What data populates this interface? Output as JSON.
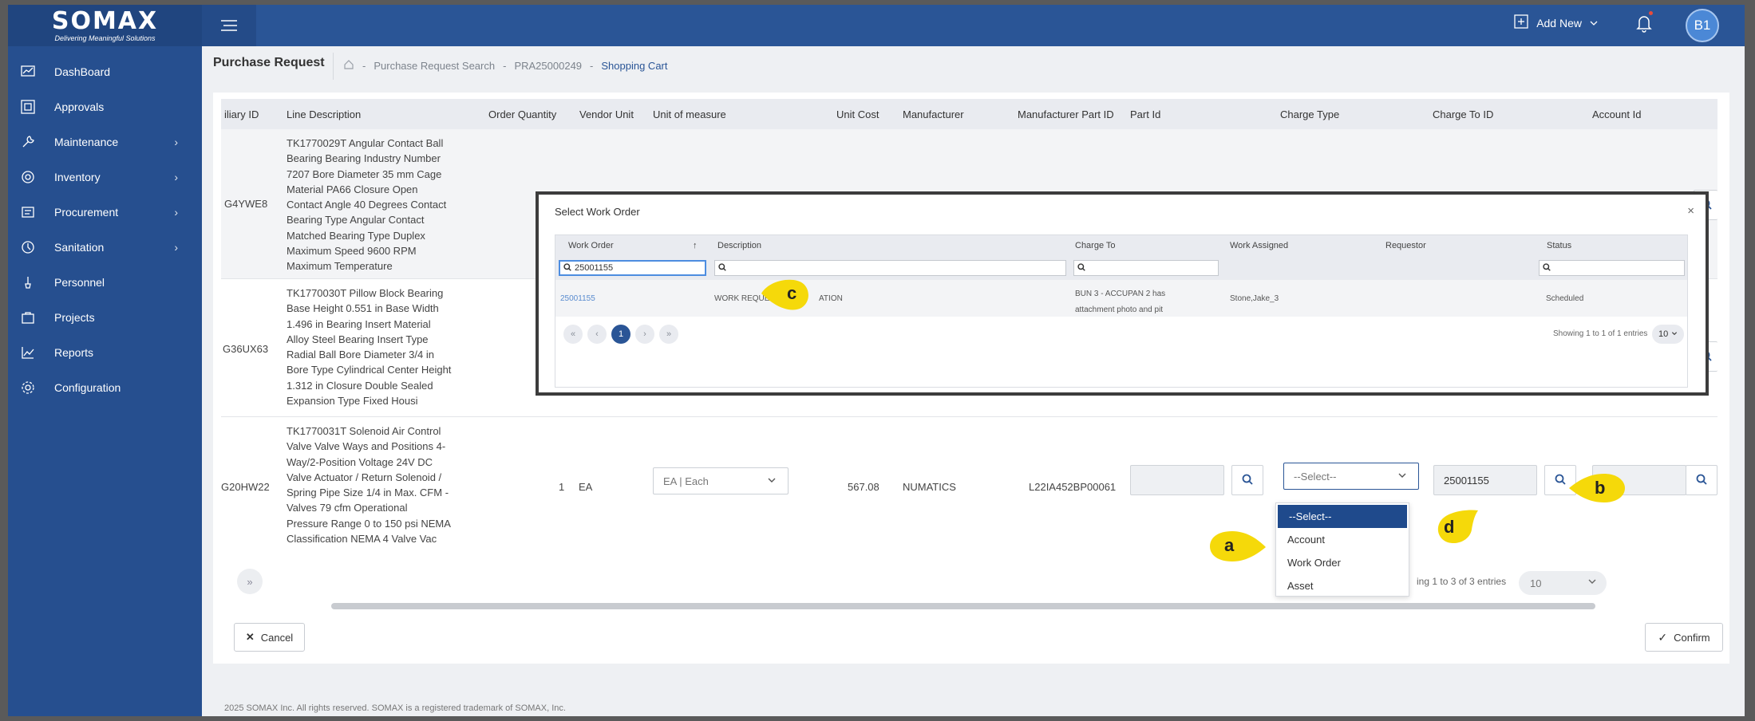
{
  "brand": {
    "name": "SOMAX",
    "tagline": "Delivering Meaningful Solutions"
  },
  "sidebar": {
    "items": [
      {
        "label": "DashBoard",
        "icon": "dashboard-icon",
        "has_children": false
      },
      {
        "label": "Approvals",
        "icon": "approvals-icon",
        "has_children": false
      },
      {
        "label": "Maintenance",
        "icon": "maintenance-icon",
        "has_children": true
      },
      {
        "label": "Inventory",
        "icon": "inventory-icon",
        "has_children": true
      },
      {
        "label": "Procurement",
        "icon": "procurement-icon",
        "has_children": true
      },
      {
        "label": "Sanitation",
        "icon": "sanitation-icon",
        "has_children": true
      },
      {
        "label": "Personnel",
        "icon": "personnel-icon",
        "has_children": false
      },
      {
        "label": "Projects",
        "icon": "projects-icon",
        "has_children": false
      },
      {
        "label": "Reports",
        "icon": "reports-icon",
        "has_children": false
      },
      {
        "label": "Configuration",
        "icon": "configuration-icon",
        "has_children": false
      }
    ]
  },
  "header": {
    "add_new": "Add New",
    "avatar": "B1"
  },
  "page": {
    "title": "Purchase Request",
    "breadcrumb": [
      "Purchase Request Search",
      "PRA25000249",
      "Shopping Cart"
    ],
    "sep": "-"
  },
  "table": {
    "columns": [
      "iliary ID",
      "Line Description",
      "Order Quantity",
      "Vendor Unit",
      "Unit of measure",
      "Unit Cost",
      "Manufacturer",
      "Manufacturer Part ID",
      "Part Id",
      "Charge Type",
      "Charge To ID",
      "Account Id"
    ],
    "rows": [
      {
        "aux_id": "G4YWE8",
        "description": [
          "TK1770029T Angular Contact Ball",
          "Bearing Bearing Industry Number",
          "7207 Bore Diameter 35 mm Cage",
          "Material PA66 Closure Open",
          "Contact Angle 40 Degrees Contact",
          "Bearing Type Angular Contact",
          "Matched Bearing Type Duplex",
          "Maximum Speed 9600 RPM",
          "Maximum Temperature"
        ]
      },
      {
        "aux_id": "G36UX63",
        "description": [
          "TK1770030T Pillow Block Bearing",
          "Base Height 0.551 in Base Width",
          "1.496 in Bearing Insert Material",
          "Alloy Steel Bearing Insert Type",
          "Radial Ball Bore Diameter 3/4 in",
          "Bore Type Cylindrical Center Height",
          "1.312 in Closure Double Sealed",
          "Expansion Type Fixed Housi"
        ]
      },
      {
        "aux_id": "G20HW22",
        "description": [
          "TK1770031T Solenoid Air Control",
          "Valve Valve Ways and Positions 4-",
          "Way/2-Position Voltage 24V DC",
          "Valve Actuator / Return Solenoid /",
          "Spring Pipe Size 1/4 in Max. CFM -",
          "Valves 79 cfm Operational",
          "Pressure Range 0 to 150 psi NEMA",
          "Classification NEMA 4 Valve Vac"
        ],
        "order_qty": "1",
        "vendor_unit": "EA",
        "uom": "EA | Each",
        "unit_cost": "567.08",
        "manufacturer": "NUMATICS",
        "mfr_part_id": "L22IA452BP00061",
        "charge_type_placeholder": "--Select--",
        "charge_to_id": "25001155"
      }
    ],
    "charge_type_options": [
      "--Select--",
      "Account",
      "Work Order",
      "Asset"
    ],
    "showing": "ing 1 to 3 of 3 entries",
    "page_size": "10"
  },
  "buttons": {
    "cancel": "Cancel",
    "confirm": "Confirm"
  },
  "footer": "2025 SOMAX Inc. All rights reserved. SOMAX is a registered trademark of SOMAX, Inc.",
  "modal": {
    "title": "Select Work Order",
    "close": "×",
    "columns": [
      "Work Order",
      "Description",
      "Charge To",
      "Work Assigned",
      "Requestor",
      "Status"
    ],
    "filter_value": "25001155",
    "rows": [
      {
        "work_order": "25001155",
        "description": "WORK REQUE",
        "description_tail": "ATION",
        "charge_to": [
          "BUN 3 - ACCUPAN 2 has",
          "attachment photo and pit"
        ],
        "work_assigned": "Stone,Jake_3",
        "requestor": "",
        "status": "Scheduled"
      }
    ],
    "page": "1",
    "showing": "Showing 1 to 1 of 1 entries",
    "page_size": "10"
  },
  "callouts": {
    "a": "a",
    "b": "b",
    "c": "c",
    "d": "d",
    "color": "#f5d90a"
  },
  "colors": {
    "sidebar": "#264f8f",
    "header": "#2a5596",
    "accent": "#1f4a8c"
  }
}
